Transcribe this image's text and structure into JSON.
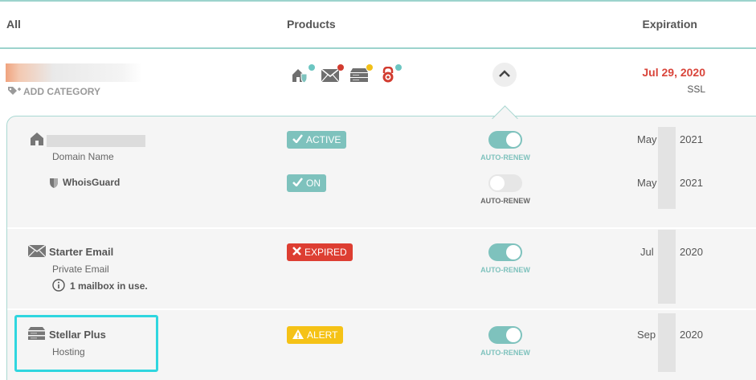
{
  "header": {
    "col_all": "All",
    "col_products": "Products",
    "col_expiration": "Expiration"
  },
  "summary": {
    "add_category": "ADD CATEGORY",
    "product_icons": [
      "domain-with-shield-icon",
      "mail-icon",
      "server-icon",
      "ssl-lock-icon"
    ],
    "dot_colors": [
      "#6cc6c2",
      "#d23b2f",
      "#f2c018",
      "#6cc6c2"
    ],
    "expiration_date": "Jul 29, 2020",
    "expiration_label": "SSL"
  },
  "items": [
    {
      "icon": "house-icon",
      "title": "",
      "subtitle": "Domain Name",
      "status": "ACTIVE",
      "status_color": "#7ec2bd",
      "auto_renew": true,
      "auto_renew_label": "AUTO-RENEW",
      "date_start": "May",
      "date_end": "2021"
    },
    {
      "icon": "shield-icon",
      "title": "WhoisGuard",
      "status": "ON",
      "status_color": "#7ec2bd",
      "auto_renew": false,
      "auto_renew_label": "AUTO-RENEW",
      "date_start": "May",
      "date_end": "2021"
    },
    {
      "icon": "mail-icon",
      "title": "Starter Email",
      "subtitle": "Private Email",
      "note": "1 mailbox in use.",
      "status": "EXPIRED",
      "status_color": "#dd3e32",
      "auto_renew": true,
      "auto_renew_label": "AUTO-RENEW",
      "date_start": "Jul",
      "date_end": "2020"
    },
    {
      "icon": "server-icon",
      "title": "Stellar Plus",
      "subtitle": "Hosting",
      "status": "ALERT",
      "status_color": "#f5c216",
      "auto_renew": true,
      "auto_renew_label": "AUTO-RENEW",
      "date_start": "Sep",
      "date_end": "2020"
    }
  ]
}
